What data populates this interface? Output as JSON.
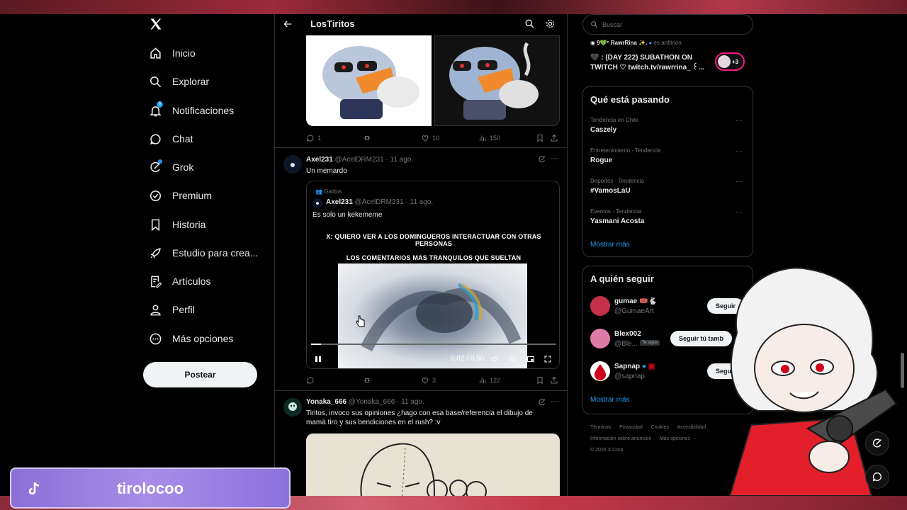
{
  "colors": {
    "background": "#000000",
    "accent": "#1d9bf0",
    "text": "#e7e9ea",
    "muted": "#71767b",
    "border": "#2f3336",
    "tiktok_banner": "#a78de8"
  },
  "nav": {
    "logo_icon": "x-logo-icon",
    "items": [
      {
        "label": "Inicio",
        "icon": "home-icon"
      },
      {
        "label": "Explorar",
        "icon": "search-icon"
      },
      {
        "label": "Notificaciones",
        "icon": "bell-icon",
        "badge": "6"
      },
      {
        "label": "Chat",
        "icon": "chat-bubble-icon"
      },
      {
        "label": "Grok",
        "icon": "grok-icon"
      },
      {
        "label": "Premium",
        "icon": "verified-badge-icon"
      },
      {
        "label": "Historia",
        "icon": "bookmark-icon"
      },
      {
        "label": "Estudio para crea...",
        "icon": "rocket-icon"
      },
      {
        "label": "Artículos",
        "icon": "article-icon"
      },
      {
        "label": "Perfil",
        "icon": "person-icon"
      },
      {
        "label": "Más opciones",
        "icon": "more-circle-icon"
      }
    ],
    "post_label": "Postear"
  },
  "main": {
    "title": "LosTiritos",
    "first_post_actions": {
      "replies": "1",
      "reposts": "",
      "likes": "10",
      "views": "150"
    },
    "tweet1": {
      "name": "Axel231",
      "handle": "@AcelDRM231 · 11 ago.",
      "text": "Un memardo",
      "quote": {
        "community": "Gatitos",
        "name": "Axel231",
        "handle": "@AcelDRM231 · 11 ago.",
        "text": "Es solo un kekememe",
        "video_caption_1": "X: QUIERO VER A LOS DOMINGUEROS INTERACTUAR CON OTRAS PERSONAS",
        "video_caption_2": "LOS COMENTARIOS MAS TRANQUILOS QUE SUELTAN",
        "video_time": "0:02 / 0:50",
        "video_progress": 0.04
      },
      "actions": {
        "replies": "",
        "reposts": "",
        "likes": "3",
        "views": "122"
      }
    },
    "tweet2": {
      "name": "Yonaka_666",
      "handle": "@Yonaka_666 · 11 ago.",
      "text": "Tiritos, invoco sus opiniones ¿hago con esa base/referencia el dibujo de mamá tiro y sus bendiciones en el rush? :v"
    }
  },
  "right": {
    "search_placeholder": "Buscar",
    "space": {
      "host_name": "9💚ᶜ RawrRina ✨.",
      "host_role": "es anfitrión",
      "title": "🖤 : (DAY 222) SUBATHON ON TWITCH ♡ twitch.tv/rawrrina_ ꒰...",
      "listeners": "+3"
    },
    "trends_title": "Qué está pasando",
    "trends": [
      {
        "category": "Tendencia en Chile",
        "name": "Caszely"
      },
      {
        "category": "Entretenimiento · Tendencia",
        "name": "Rogue"
      },
      {
        "category": "Deportes · Tendencia",
        "name": "#VamosLaU"
      },
      {
        "category": "Eventos · Tendencia",
        "name": "Yasmani Acosta"
      }
    ],
    "show_more": "Mostrar más",
    "who_to_follow_title": "A quién seguir",
    "follows": [
      {
        "name": "gumae 🎟️🐇",
        "handle": "@GumaeArt",
        "button": "Seguir"
      },
      {
        "name": "Blex002",
        "handle": "@Ble...",
        "badge": "Te sigue",
        "button": "Seguir tú tamb"
      },
      {
        "name": "Sapnap",
        "handle": "@sapnap",
        "button": "Segu"
      }
    ],
    "footer": [
      "Términos",
      "Privacidad",
      "Cookies",
      "Accesibilidad",
      "Información sobre anuncios",
      "Más opciones ···",
      "© 2026 X Corp."
    ]
  },
  "overlay": {
    "tiktok_username": "tirolocoo"
  }
}
